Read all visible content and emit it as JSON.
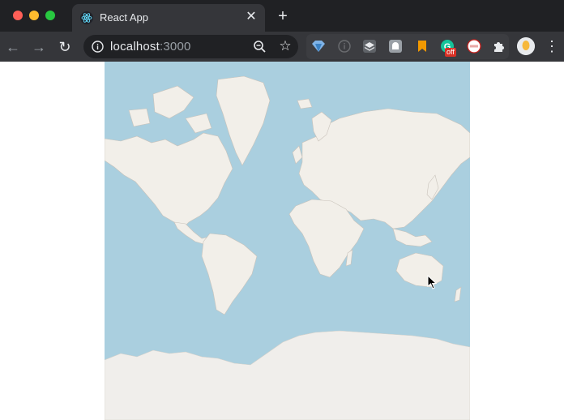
{
  "browser": {
    "tab": {
      "title": "React App",
      "favicon": "react-logo-icon"
    },
    "address_bar": {
      "host": "localhost",
      "port": ":3000"
    }
  },
  "icons": {
    "back": "back-arrow-icon",
    "forward": "forward-arrow-icon",
    "reload": "reload-icon",
    "zoom": "zoom-icon",
    "star": "bookmark-star-icon",
    "extensions": "puzzle-icon",
    "menu": "menu-dots-icon"
  },
  "extensions": {
    "badge_label": "off"
  },
  "map": {
    "description_colors": {
      "water": "#aacfdf",
      "land": "#f2efe9",
      "ice": "#f0eeeb"
    }
  }
}
